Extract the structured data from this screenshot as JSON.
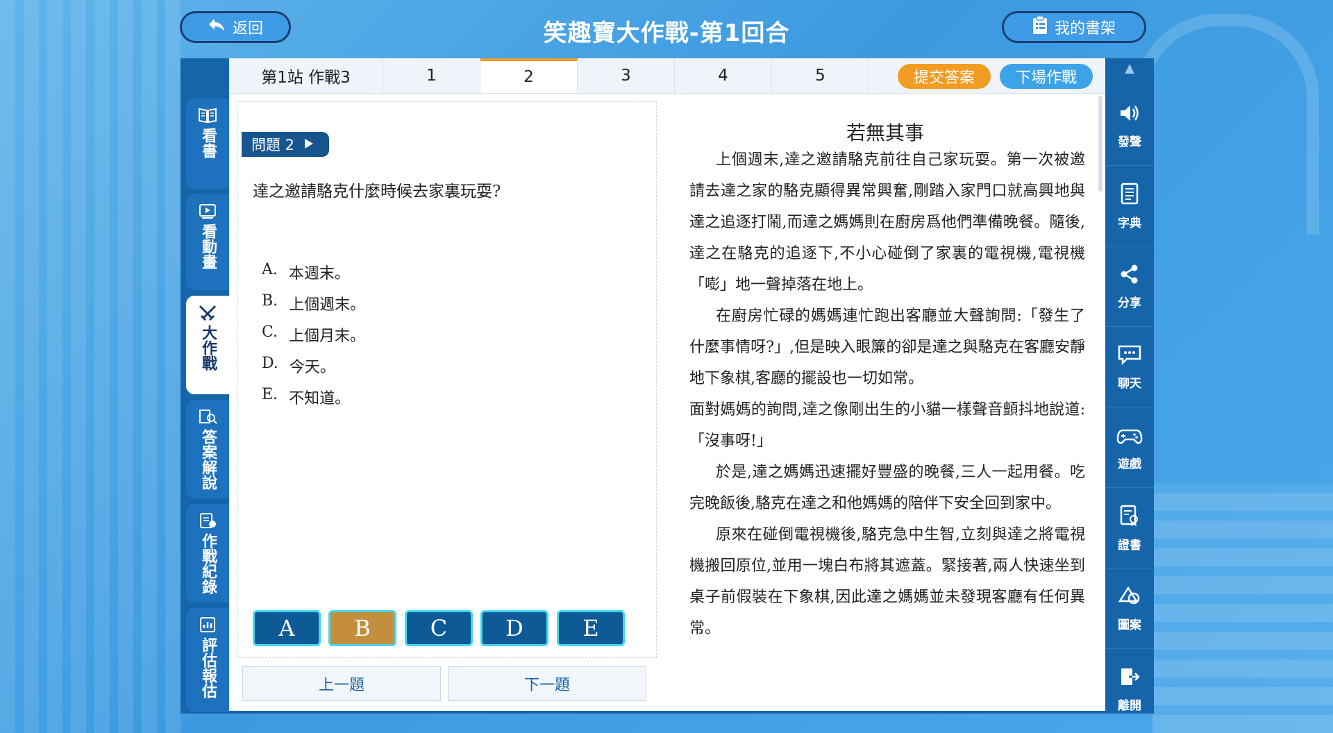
{
  "header": {
    "back_label": "返回",
    "title": "笑趣寶大作戰-第1回合",
    "bookshelf_label": "我的書架"
  },
  "left_nav": [
    {
      "label": "看書",
      "icon": "book-icon"
    },
    {
      "label": "看動畫",
      "icon": "video-icon"
    },
    {
      "label": "大作戰",
      "icon": "crossed-swords-icon",
      "active": true
    },
    {
      "label": "答案解說",
      "icon": "answer-search-icon"
    },
    {
      "label": "作戰紀錄",
      "icon": "record-icon"
    },
    {
      "label": "評估報估",
      "icon": "report-icon"
    }
  ],
  "right_nav": [
    {
      "label": "發聲",
      "icon": "speaker-icon"
    },
    {
      "label": "字典",
      "icon": "dictionary-icon"
    },
    {
      "label": "分享",
      "icon": "share-icon"
    },
    {
      "label": "聊天",
      "icon": "chat-icon"
    },
    {
      "label": "遊戲",
      "icon": "gamepad-icon"
    },
    {
      "label": "證書",
      "icon": "certificate-icon"
    },
    {
      "label": "圖案",
      "icon": "shapes-icon"
    },
    {
      "label": "離開",
      "icon": "exit-icon"
    }
  ],
  "tabs": [
    {
      "label": "第1站 作戰3"
    },
    {
      "label": "1"
    },
    {
      "label": "2",
      "active": true
    },
    {
      "label": "3"
    },
    {
      "label": "4"
    },
    {
      "label": "5"
    }
  ],
  "actions": {
    "submit_label": "提交答案",
    "exit_label": "下場作戰"
  },
  "question": {
    "badge": "問題 2",
    "text": "達之邀請駱克什麼時候去家裏玩耍?",
    "options": [
      {
        "letter": "A.",
        "text": "本週末。"
      },
      {
        "letter": "B.",
        "text": "上個週末。"
      },
      {
        "letter": "C.",
        "text": "上個月末。"
      },
      {
        "letter": "D.",
        "text": "今天。"
      },
      {
        "letter": "E.",
        "text": "不知道。"
      }
    ],
    "answer_buttons": [
      "A",
      "B",
      "C",
      "D",
      "E"
    ],
    "selected": "B",
    "prev_label": "上一題",
    "next_label": "下一題"
  },
  "article": {
    "title": "若無其事",
    "paragraphs": [
      {
        "indent": true,
        "text": "上個週末,達之邀請駱克前往自己家玩耍。第一次被邀請去達之家的駱克顯得異常興奮,剛踏入家門口就高興地與達之追逐打鬧,而達之媽媽則在廚房爲他們準備晚餐。隨後,達之在駱克的追逐下,不小心碰倒了家裏的電視機,電視機「嘭」地一聲掉落在地上。"
      },
      {
        "indent": true,
        "text": "在廚房忙碌的媽媽連忙跑出客廳並大聲詢問:「發生了什麼事情呀?」,但是映入眼簾的卻是達之與駱克在客廳安靜地下象棋,客廳的擺設也一切如常。"
      },
      {
        "indent": false,
        "text": "面對媽媽的詢問,達之像剛出生的小貓一樣聲音顫抖地說道:「沒事呀!」"
      },
      {
        "indent": true,
        "text": "於是,達之媽媽迅速擺好豐盛的晚餐,三人一起用餐。吃完晚飯後,駱克在達之和他媽媽的陪伴下安全回到家中。"
      },
      {
        "indent": true,
        "text": "原來在碰倒電視機後,駱克急中生智,立刻與達之將電視機搬回原位,並用一塊白布將其遮蓋。緊接著,兩人快速坐到桌子前假裝在下象棋,因此達之媽媽並未發現客廳有任何異常。"
      }
    ]
  },
  "colors": {
    "frame": "#1665ab",
    "accent_orange": "#f39c23",
    "selected_answer": "#c48f3d",
    "answer_button": "#0e5a96"
  }
}
